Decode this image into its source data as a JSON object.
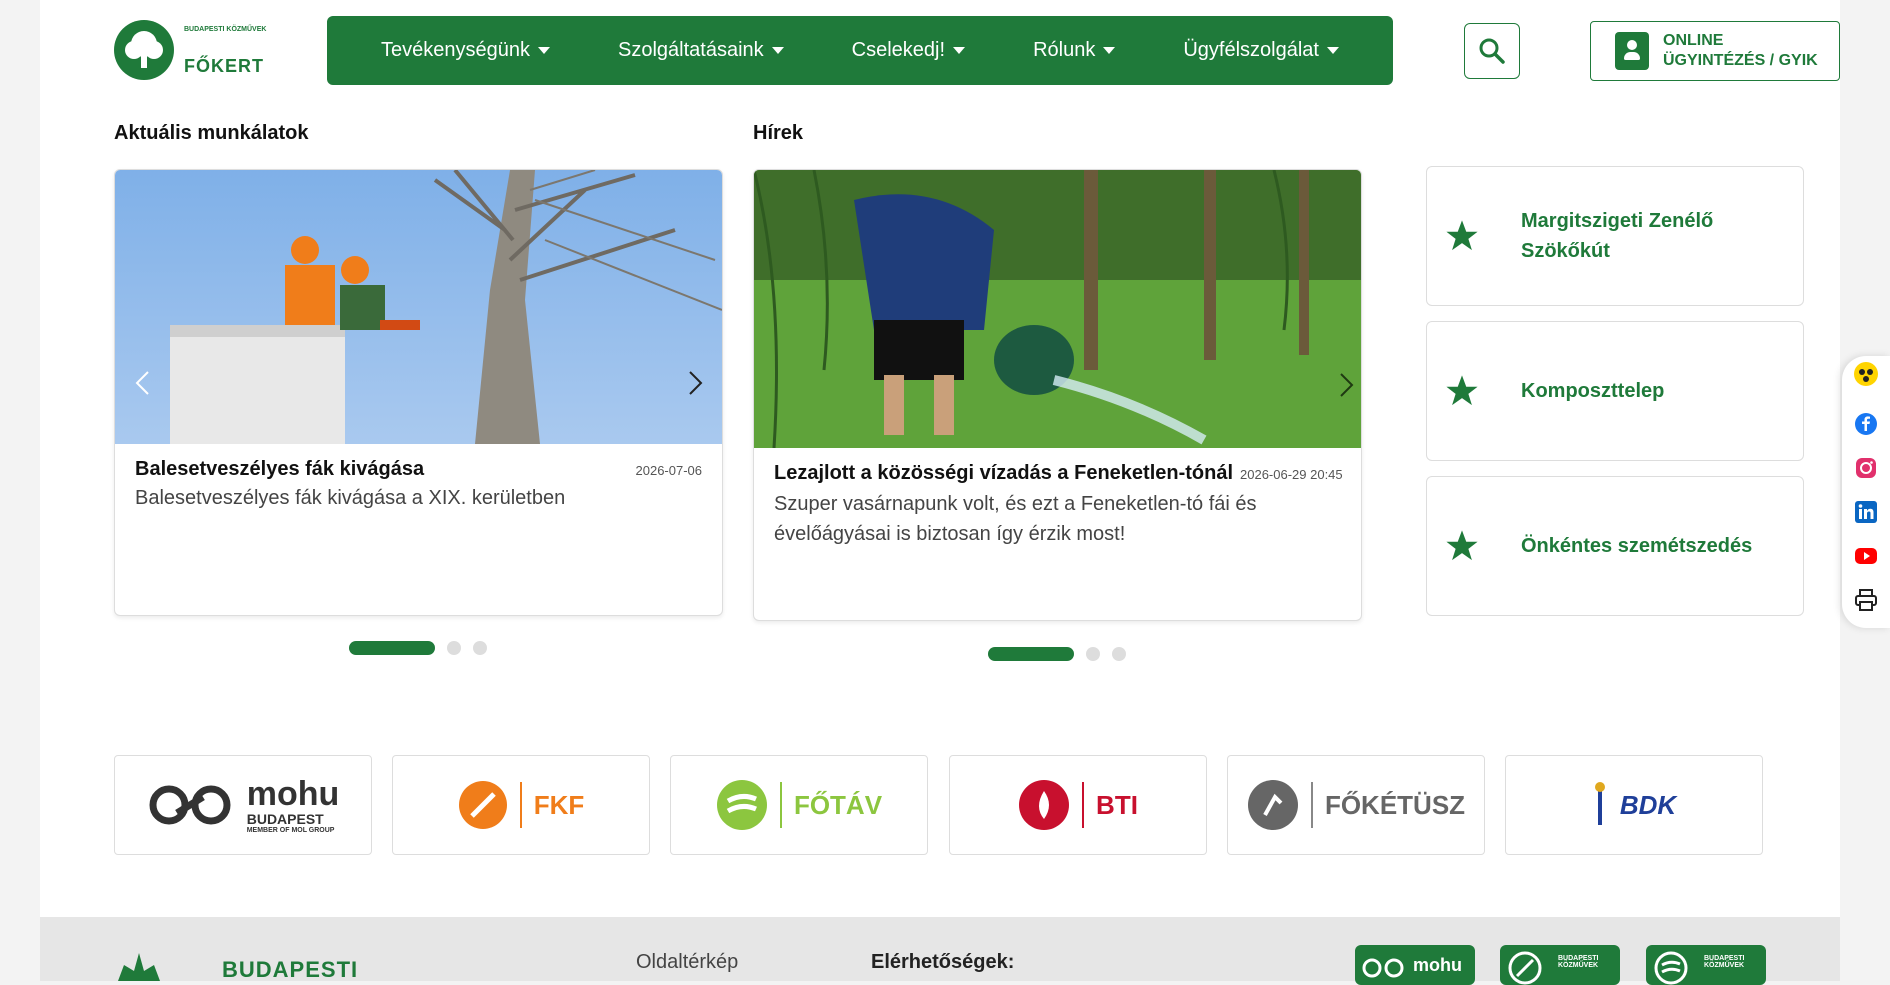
{
  "header": {
    "logo_subtitle": "BUDAPESTI KÖZMŰVEK",
    "logo_name": "FŐKERT",
    "nav": [
      {
        "label": "Tevékenységünk"
      },
      {
        "label": "Szolgáltatásaink"
      },
      {
        "label": "Cselekedj!"
      },
      {
        "label": "Rólunk"
      },
      {
        "label": "Ügyfélszolgálat"
      }
    ],
    "online_line1": "ONLINE",
    "online_line2": "ÜGYINTÉZÉS / GYIK"
  },
  "works": {
    "title": "Aktuális munkálatok",
    "card": {
      "title": "Balesetveszélyes fák kivágása",
      "date": "2026-07-06",
      "description": "Balesetveszélyes fák kivágása a XIX. kerületben"
    }
  },
  "news": {
    "title": "Hírek",
    "card": {
      "title": "Lezajlott a közösségi vízadás a Feneketlen-tónál",
      "date": "2026-06-29 20:45",
      "description": "Szuper vasárnapunk volt, és ezt a Feneketlen-tó fái és évelőágyásai is biztosan így érzik most!"
    }
  },
  "quick_links": [
    {
      "label": "Margitszigeti Zenélő Szökőkút"
    },
    {
      "label": "Komposzttelep"
    },
    {
      "label": "Önkéntes szemétszedés"
    }
  ],
  "partners": [
    {
      "name": "mohu",
      "sub": "BUDAPEST",
      "tag": "MEMBER OF MOL GROUP",
      "color": "#333333"
    },
    {
      "name": "FKF",
      "color": "#f07d1a"
    },
    {
      "name": "FŐTÁV",
      "color": "#8cc63f"
    },
    {
      "name": "BTI",
      "color": "#c8102e"
    },
    {
      "name": "FŐKÉTÜSZ",
      "color": "#666666"
    },
    {
      "name": "BDK",
      "color": "#1f3f99"
    }
  ],
  "footer": {
    "brand": "BUDAPESTI",
    "sitemap": "Oldaltérkép",
    "contacts": "Elérhetőségek:",
    "badge_mohu": "mohu",
    "badge_sub": "BUDAPESTI KÖZMŰVEK"
  },
  "colors": {
    "brand_green": "#1f7a3a",
    "facebook": "#1877f2",
    "instagram": "#e1306c",
    "linkedin": "#0a66c2",
    "youtube": "#ff0000",
    "accessibility": "#ffd400"
  },
  "social_icons": [
    "accessibility-icon",
    "facebook-icon",
    "instagram-icon",
    "linkedin-icon",
    "youtube-icon",
    "print-icon"
  ]
}
